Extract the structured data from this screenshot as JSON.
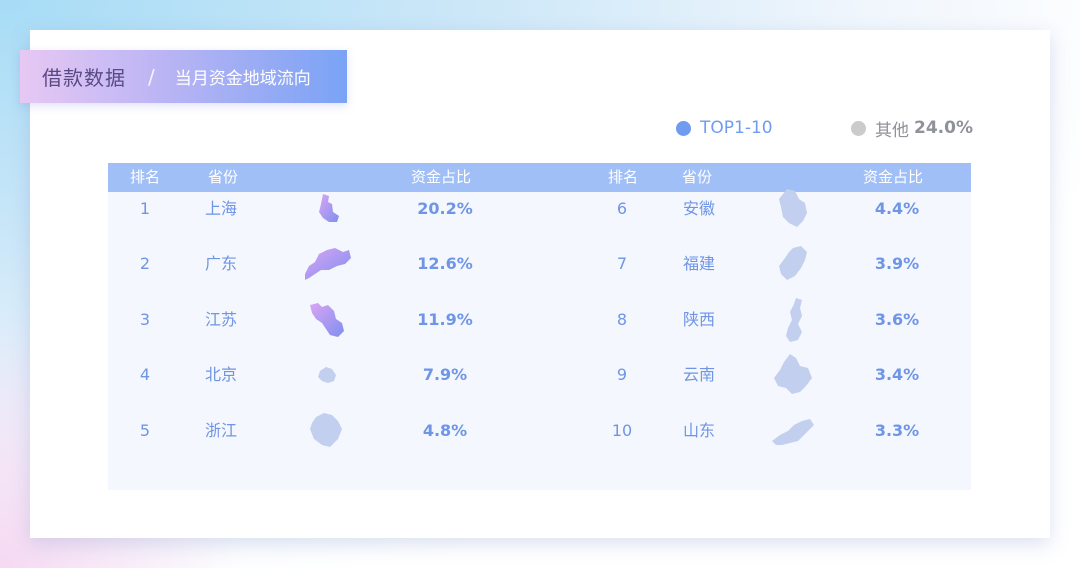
{
  "header": {
    "title": "借款数据",
    "separator": "/",
    "subtitle": "当月资金地域流向"
  },
  "legend": {
    "top_label": "TOP1-10",
    "other_label": "其他",
    "other_value": "24.0%",
    "top_color": "#6f9cf0",
    "other_color": "#cbcbcb"
  },
  "table": {
    "headers": {
      "rank": "排名",
      "province": "省份",
      "share": "资金占比"
    },
    "left_rows": [
      {
        "rank": "1",
        "province": "上海",
        "share": "20.2%",
        "map_icon": "shanghai-map-icon"
      },
      {
        "rank": "2",
        "province": "广东",
        "share": "12.6%",
        "map_icon": "guangdong-map-icon"
      },
      {
        "rank": "3",
        "province": "江苏",
        "share": "11.9%",
        "map_icon": "jiangsu-map-icon"
      },
      {
        "rank": "4",
        "province": "北京",
        "share": "7.9%",
        "map_icon": "beijing-map-icon"
      },
      {
        "rank": "5",
        "province": "浙江",
        "share": "4.8%",
        "map_icon": "zhejiang-map-icon"
      }
    ],
    "right_rows": [
      {
        "rank": "6",
        "province": "安徽",
        "share": "4.4%",
        "map_icon": "anhui-map-icon"
      },
      {
        "rank": "7",
        "province": "福建",
        "share": "3.9%",
        "map_icon": "fujian-map-icon"
      },
      {
        "rank": "8",
        "province": "陕西",
        "share": "3.6%",
        "map_icon": "shaanxi-map-icon"
      },
      {
        "rank": "9",
        "province": "云南",
        "share": "3.4%",
        "map_icon": "yunnan-map-icon"
      },
      {
        "rank": "10",
        "province": "山东",
        "share": "3.3%",
        "map_icon": "shandong-map-icon"
      }
    ]
  },
  "colors": {
    "accent_gradient_start": "#e7c8f3",
    "accent_gradient_end": "#7aa3f5",
    "table_header": "#a1bff7",
    "highlight_map_start": "#d9a5f3",
    "highlight_map_end": "#7f8ff0",
    "muted_map": "#c3cfee"
  }
}
